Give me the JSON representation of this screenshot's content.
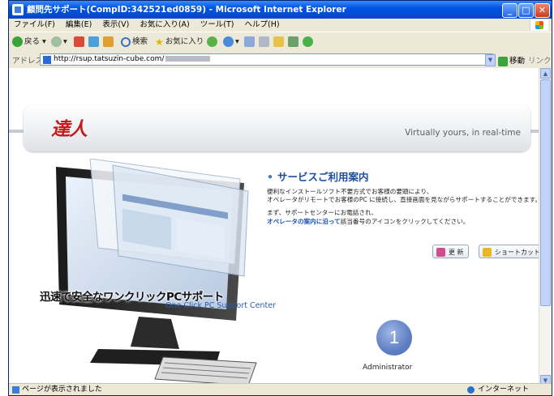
{
  "window": {
    "title": "顧問先サポート(CompID:342521ed0859) - Microsoft Internet Explorer",
    "minimize": "_",
    "maximize": "□",
    "close": "✕"
  },
  "menu": [
    "ファイル(F)",
    "編集(E)",
    "表示(V)",
    "お気に入り(A)",
    "ツール(T)",
    "ヘルプ(H)"
  ],
  "toolbar": {
    "back": "戻る",
    "search": "検索",
    "favorites": "お気に入り"
  },
  "address": {
    "label": "アドレス(D)",
    "url": "http://rsup.tatsuzin-cube.com/",
    "go": "移動",
    "links": "リンク »"
  },
  "page": {
    "logo": "達人",
    "tagline": "Virtually yours, in real-time",
    "heading": "サービスご利用案内",
    "desc1": "便利なインストールソフト不要方式でお客様の要頭により、",
    "desc2": "オペレータがリモートでお客様のPC に接続し、直接画面を見ながらサポートすることができます。",
    "desc3": "まず、サポートセンターにお電話され、",
    "desc4_link": "オペレータの案内に沿って",
    "desc4_rest": "該当番号のアイコンをクリックしてください。",
    "refresh_button": "更 新",
    "shortcut_button": "ショートカット",
    "slogan": "迅速で安全なワンクリックPCサポート",
    "subslogan": "One Click PC Support Center",
    "badge_number": "1",
    "badge_label": "Administrator"
  },
  "status": {
    "left": "ページが表示されました",
    "zone": "インターネット"
  },
  "colors": {
    "titlebar": "#0054e3",
    "heading": "#1c4ea0",
    "logo": "#c31b1b",
    "badge": "#5f7fc4"
  }
}
